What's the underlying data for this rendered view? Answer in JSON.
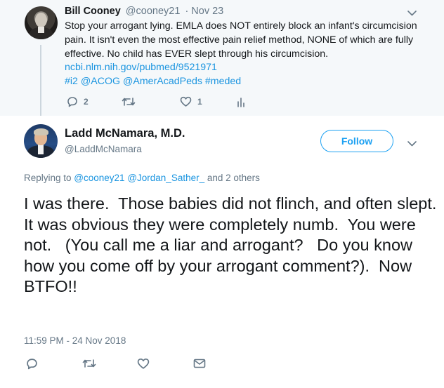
{
  "parent_tweet": {
    "author_name": "Bill Cooney",
    "author_handle": "@cooney21",
    "date": "· Nov 23",
    "text": "Stop your arrogant lying. EMLA does NOT entirely block an infant's circumcision pain. It isn't even the most effective pain relief method, NONE of which are fully effective. No child has EVER slept through his circumcision.",
    "link": "ncbi.nlm.nih.gov/pubmed/9521971",
    "hashtags": "#i2 @ACOG @AmerAcadPeds #meded",
    "actions": {
      "reply_icon": "reply-icon",
      "reply_count": "2",
      "retweet_icon": "retweet-icon",
      "like_icon": "heart-icon",
      "like_count": "1",
      "analytics_icon": "analytics-icon"
    }
  },
  "main_tweet": {
    "author_name": "Ladd McNamara, M.D.",
    "author_handle": "@LaddMcNamara",
    "follow_label": "Follow",
    "replying_prefix": "Replying to ",
    "mention_1": "@cooney21",
    "mention_2": "@Jordan_Sather_",
    "replying_suffix": " and 2 others",
    "text": "I was there.  Those babies did not flinch, and often slept.  It was obvious they were completely numb.  You were not.   (You call me a liar and arrogant?   Do you know how you come off by your arrogant comment?).  Now BTFO!!",
    "timestamp": "11:59 PM - 24 Nov 2018",
    "actions": {
      "reply_icon": "reply-icon",
      "retweet_icon": "retweet-icon",
      "like_icon": "heart-icon",
      "message_icon": "envelope-icon"
    }
  },
  "colors": {
    "link": "#1b95e0",
    "follow": "#1da1f2",
    "muted": "#657786",
    "parent_bg": "#f5f8fa"
  }
}
